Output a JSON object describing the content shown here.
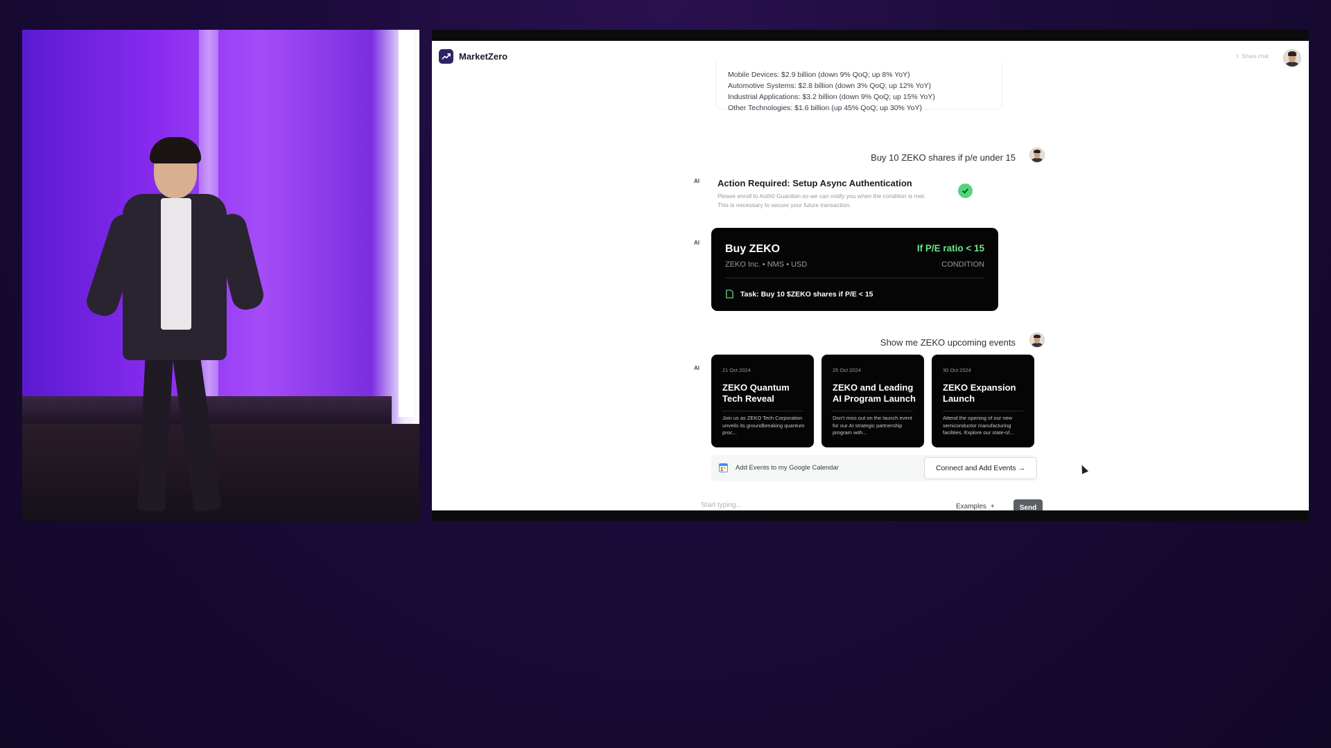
{
  "app": {
    "name": "MarketZero",
    "share_label": "Share chat"
  },
  "segments": [
    "Mobile Devices: $2.9 billion (down 9% QoQ; up 8% YoY)",
    "Automotive Systems: $2.8 billion (down 3% QoQ; up 12% YoY)",
    "Industrial Applications: $3.2 billion (down 9% QoQ; up 15% YoY)",
    "Other Technologies: $1.6 billion (up 45% QoQ; up 30% YoY)"
  ],
  "messages": {
    "user_1": "Buy 10 ZEKO shares if p/e under 15",
    "user_2": "Show me ZEKO upcoming events",
    "ai_tag": "AI"
  },
  "auth": {
    "title": "Action Required: Setup Async Authentication",
    "line1": "Please enroll to Auth0 Guardian so we can notify you when the condition is met.",
    "line2": "This is necessary to secure your future transaction."
  },
  "buy_card": {
    "title": "Buy ZEKO",
    "subtitle": "ZEKO Inc. • NMS • USD",
    "condition": "If P/E ratio < 15",
    "condition_label": "CONDITION",
    "task": "Task: Buy 10 $ZEKO shares if P/E < 15"
  },
  "events": [
    {
      "date": "21 Oct 2024",
      "title": "ZEKO Quantum Tech Reveal",
      "desc": "Join us as ZEKO Tech Corporation unveils its groundbreaking quantum proc..."
    },
    {
      "date": "25 Oct 2024",
      "title": "ZEKO and Leading AI Program Launch",
      "desc": "Don't miss out on the launch event for our AI strategic partnership program with..."
    },
    {
      "date": "30 Oct 2024",
      "title": "ZEKO Expansion Launch",
      "desc": "Attend the opening of our new semiconductor manufacturing facilities. Explore our state-of..."
    }
  ],
  "calendar": {
    "label": "Add Events to my Google Calendar",
    "button": "Connect and Add Events",
    "arrow": "→"
  },
  "composer": {
    "placeholder": "Start typing...",
    "examples": "Examples",
    "examples_icon": "+",
    "send": "Send"
  },
  "icons": {
    "logo": "trend-up-icon",
    "share": "share-icon",
    "check": "check-icon",
    "task": "document-icon",
    "calendar": "google-calendar-icon"
  },
  "colors": {
    "brand": "#2c2466",
    "condition_green": "#6ee58b",
    "check_green": "#57d37c",
    "send_button": "#5b5f66"
  }
}
